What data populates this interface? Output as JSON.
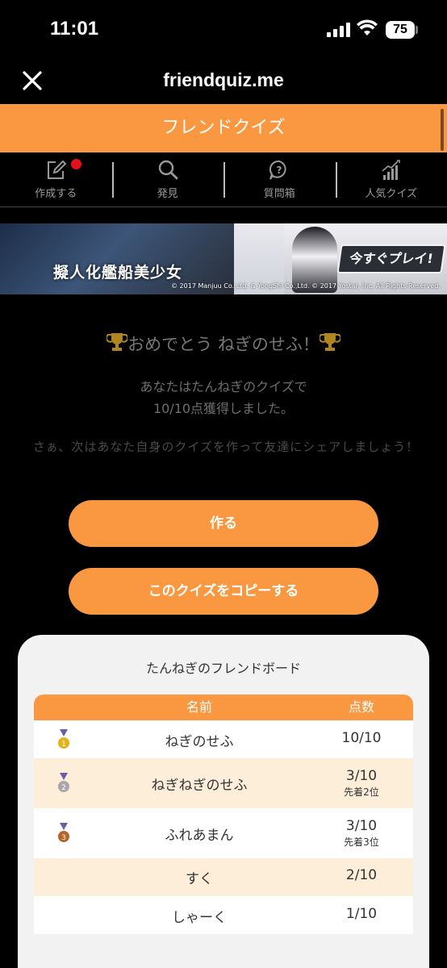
{
  "status_bar": {
    "time": "11:01",
    "battery": "75"
  },
  "nav": {
    "title": "friendquiz.me"
  },
  "header": {
    "title": "フレンドクイズ"
  },
  "menu": [
    {
      "label": "作成する",
      "icon": "edit-icon"
    },
    {
      "label": "発見",
      "icon": "search-icon"
    },
    {
      "label": "質問箱",
      "icon": "question-bubble-icon"
    },
    {
      "label": "人気クイズ",
      "icon": "trending-icon"
    }
  ],
  "banner": {
    "title": "擬人化艦船美少女",
    "play": "今すぐプレイ!",
    "copyright": "© 2017 Manjuu Co.,Ltd. & YongShi Co.,Ltd.   © 2017 Yostar, Inc. All Rights Reserved."
  },
  "congrats": {
    "text": "おめでとう ねぎのせふ！",
    "result_line1": "あなたはたんねぎのクイズで",
    "result_line2": "10/10点獲得しました。",
    "invite": "さぁ、次はあなた自身のクイズを作って友達にシェアしましょう！"
  },
  "buttons": {
    "create": "作る",
    "copy": "このクイズをコピーする"
  },
  "board": {
    "title": "たんねぎのフレンドボード",
    "headers": {
      "name": "名前",
      "score": "点数"
    },
    "rows": [
      {
        "rank": "1",
        "name": "ねぎのせふ",
        "score": "10/10",
        "note": ""
      },
      {
        "rank": "2",
        "name": "ねぎねぎのせふ",
        "score": "3/10",
        "note": "先着2位"
      },
      {
        "rank": "3",
        "name": "ふれあまん",
        "score": "3/10",
        "note": "先着3位"
      },
      {
        "rank": "",
        "name": "すく",
        "score": "2/10",
        "note": ""
      },
      {
        "rank": "",
        "name": "しゃーく",
        "score": "1/10",
        "note": ""
      }
    ]
  },
  "colors": {
    "accent": "#f99840",
    "row_alt": "#fdeeda",
    "notification_dot": "#e5101c"
  }
}
